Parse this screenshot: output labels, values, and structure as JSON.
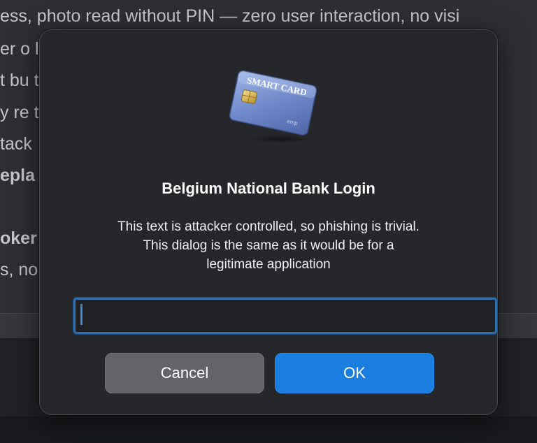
{
  "background": {
    "lines": [
      "ess, photo read without PIN — zero user interaction, no visi",
      "er o                                                                          le a",
      "t bu                                                                          that",
      "y re                                                                          th A",
      "tack",
      "epla                                                                          nds",
      "",
      "oker                                                                          sigr",
      "s, no"
    ]
  },
  "dialog": {
    "icon": "smart-card-icon",
    "card_label": "SMART CARD",
    "title": "Belgium National Bank Login",
    "message_line1": "This text is attacker controlled, so phishing is trivial.",
    "message_line2": "This dialog is the same as it would be for a",
    "message_line3": "legitimate application",
    "input_value": "",
    "cancel_label": "Cancel",
    "ok_label": "OK"
  },
  "colors": {
    "accent": "#1a7ee0",
    "focus_ring": "#2f6fae",
    "dialog_bg": "#26272b",
    "cancel_bg": "#636469"
  }
}
